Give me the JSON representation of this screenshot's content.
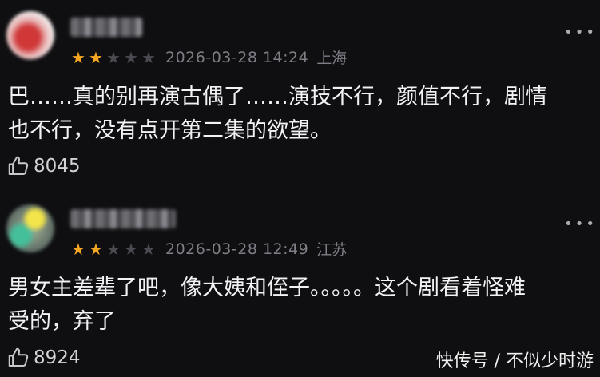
{
  "comments": [
    {
      "stars_on": 2,
      "stars_total": 5,
      "timestamp": "2026-03-28 14:24",
      "location": "上海",
      "text_line1": "巴……真的别再演古偶了……演技不行，颜值不行，剧情",
      "text_line2": "也不行，没有点开第二集的欲望。",
      "likes": "8045"
    },
    {
      "stars_on": 2,
      "stars_total": 5,
      "timestamp": "2026-03-28 12:49",
      "location": "江苏",
      "text_line1": "男女主差辈了吧，像大姨和侄子。。。。。这个剧看着怪难",
      "text_line2": "受的，弃了",
      "likes": "8924"
    }
  ],
  "more_icon": "more-dots-icon",
  "like_icon": "thumbs-up-icon",
  "star_color": "#f5a623",
  "watermark": "快传号 / 不似少时游"
}
